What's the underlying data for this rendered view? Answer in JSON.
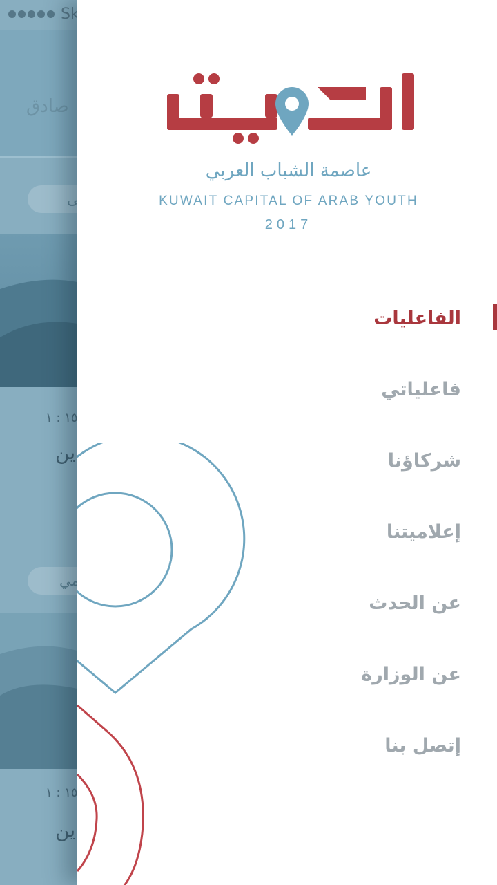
{
  "status_bar": {
    "carrier": "Sk"
  },
  "background_screen": {
    "header_title": "صادق",
    "cards": [
      {
        "chip": "منى",
        "time": "١٥ : ١",
        "title": "ين"
      },
      {
        "chip": "قيمي",
        "time": "١٥ : ١",
        "title": "ين"
      }
    ]
  },
  "drawer": {
    "logo": {
      "title": "الكويت",
      "subtitle_ar": "عاصمة الشباب العربي",
      "subtitle_en": "KUWAIT CAPITAL OF ARAB YOUTH",
      "year": "2017"
    },
    "menu": [
      {
        "label": "الفاعليات",
        "active": true
      },
      {
        "label": "فاعلياتي",
        "active": false
      },
      {
        "label": "شركاؤنا",
        "active": false
      },
      {
        "label": "إعلاميتنا",
        "active": false
      },
      {
        "label": "عن الحدث",
        "active": false
      },
      {
        "label": "عن الوزارة",
        "active": false
      },
      {
        "label": "إتصل بنا",
        "active": false
      }
    ]
  },
  "colors": {
    "brand_red": "#a9373d",
    "brand_blue": "#6fa6c0",
    "menu_inactive": "#a0a8ae",
    "overlay_bg": "#88aec0"
  },
  "icons": [
    "location-pin-icon"
  ]
}
